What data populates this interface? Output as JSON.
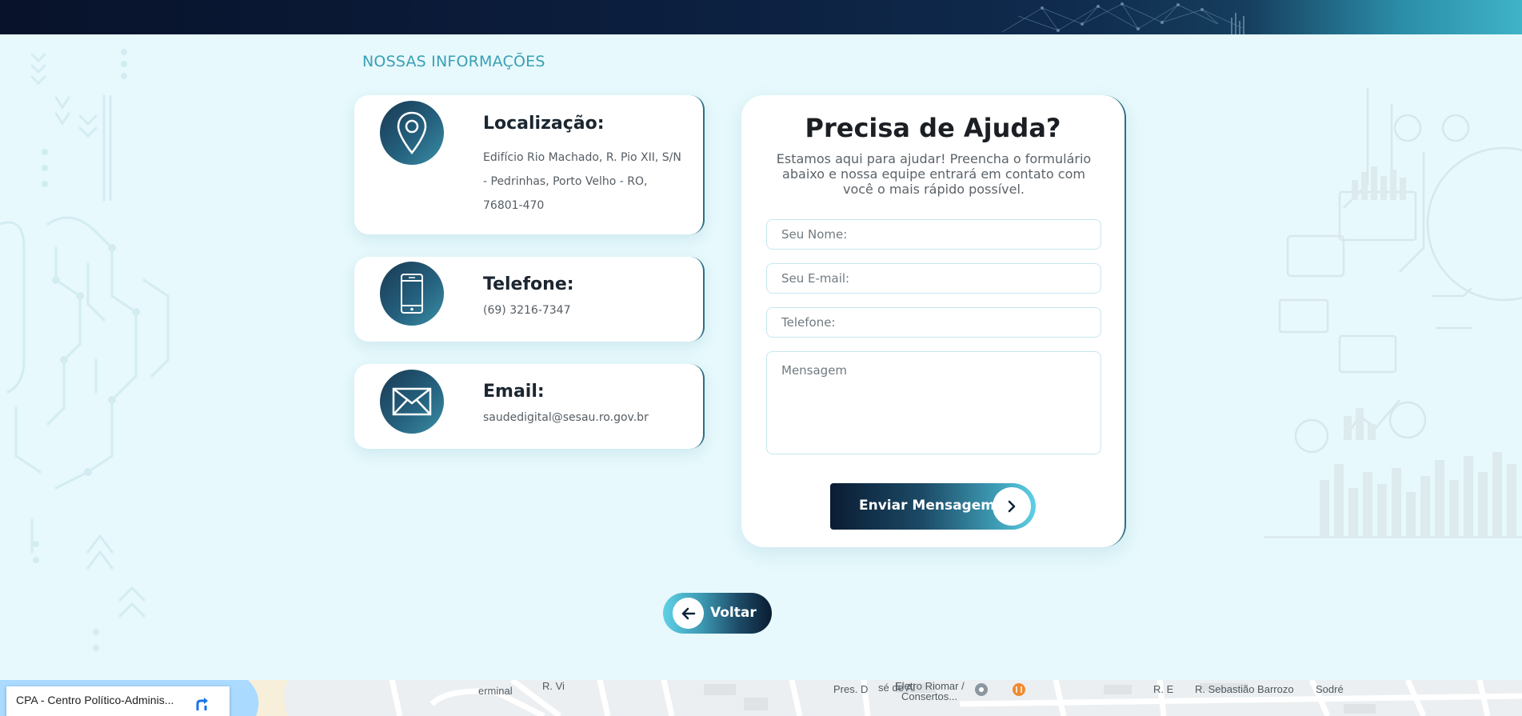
{
  "section_title": "NOSSAS INFORMAÇÕES",
  "info_cards": [
    {
      "icon": "location-pin-icon",
      "title": "Localização:",
      "text": "Edifício Rio Machado, R. Pio XII, S/N - Pedrinhas, Porto Velho - RO, 76801-470"
    },
    {
      "icon": "phone-icon",
      "title": "Telefone:",
      "text": "(69) 3216-7347"
    },
    {
      "icon": "envelope-icon",
      "title": "Email:",
      "text": "saudedigital@sesau.ro.gov.br"
    }
  ],
  "form": {
    "title": "Precisa de Ajuda?",
    "subtitle": "Estamos aqui para ajudar! Preencha o formulário abaixo e nossa equipe entrará em contato com você o mais rápido possível.",
    "name_placeholder": "Seu Nome:",
    "email_placeholder": "Seu E-mail:",
    "phone_placeholder": "Telefone:",
    "message_placeholder": "Mensagem",
    "submit_label": "Enviar Mensagem"
  },
  "back_label": "Voltar",
  "map": {
    "place_name": "CPA - Centro Político-Adminis...",
    "labels": {
      "street_1": "R. Vi",
      "street_2": "erminal",
      "street_3": "Pres. D",
      "street_4": "sé de Al",
      "poi_1_line1": "Eletro Riomar /",
      "poi_1_line2": "Consertos...",
      "street_5": "R. E",
      "street_6": "R. Sebastião Barrozo",
      "street_7": "Sodré"
    }
  },
  "colors": {
    "accent": "#3a9fb5",
    "page_background": "#e7f9fc",
    "card_background": "#ffffff",
    "icon_gradient_dark": "#1a3953",
    "icon_gradient_light": "#3a8ea6"
  }
}
